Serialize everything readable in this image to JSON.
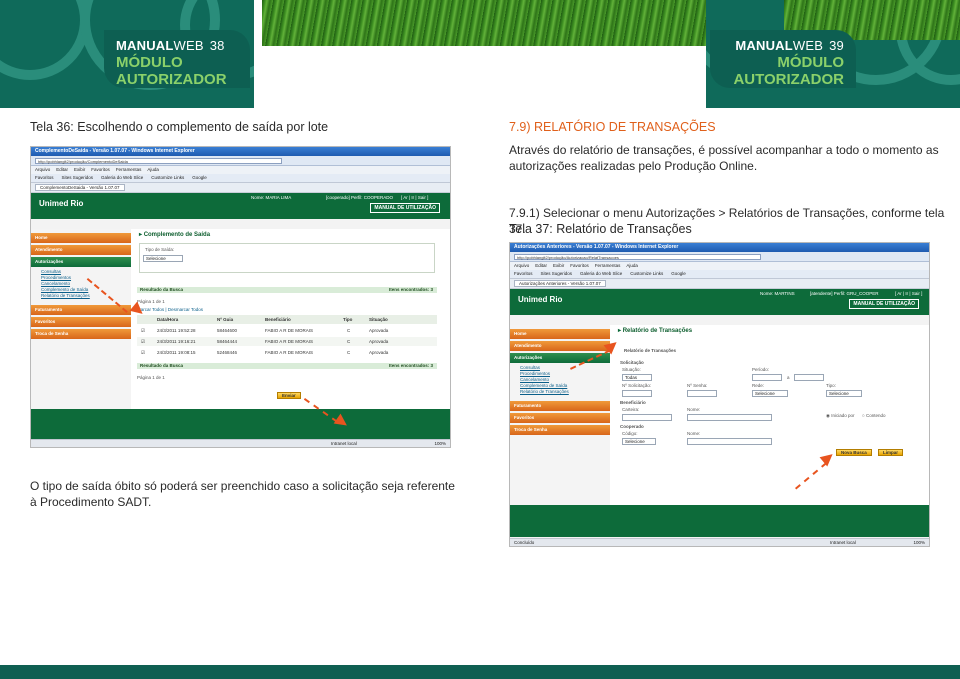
{
  "header": {
    "left": {
      "brand_bold": "MANUAL",
      "brand_light": "WEB",
      "page_number": "38",
      "module_line1": "MÓDULO",
      "module_line2": "AUTORIZADOR"
    },
    "right": {
      "brand_bold": "MANUAL",
      "brand_light": "WEB",
      "page_number": "39",
      "module_line1": "MÓDULO",
      "module_line2": "AUTORIZADOR"
    }
  },
  "left_page": {
    "caption": "Tela 36: Escolhendo o complemento de saída por lote",
    "note": "O tipo de saída óbito só poderá ser preenchido caso a solicitação seja referente à Procedimento SADT."
  },
  "right_page": {
    "heading": "7.9) RELATÓRIO DE TRANSAÇÕES",
    "intro": "Através do relatório de transações, é possível acompanhar a todo o momento as autorizações realizadas pelo Produção Online.",
    "step": "7.9.1) Selecionar o menu Autorizações > Relatórios de Transações, conforme tela 37.",
    "caption": "Tela 37: Relatório de Transações"
  },
  "screenshot1": {
    "window_title": "ComplementoDeSaida - Versão 1.07.07 - Windows Internet Explorer",
    "address": "http://pobhlanglt2/produção/ComplementoDeSaida",
    "menu": [
      "Arquivo",
      "Editar",
      "Exibir",
      "Favoritos",
      "Ferramentas",
      "Ajuda"
    ],
    "favorites": [
      "Favoritos",
      "Sites Sugeridos",
      "Galeria do Web Slice",
      "Customize Links",
      "Google"
    ],
    "tab": "ComplementoDeSaida - Versão 1.07.07",
    "logo": "Unimed Rio",
    "user": "Nome: MARIA LIMA",
    "profile": "[cooperado] Perfil: COOPERADO",
    "links": "[ Ar | Ir | Sair ]",
    "manual_btn": "MANUAL DE UTILIZAÇÃO",
    "sidebar": [
      "Home",
      "Atendimento",
      "Autorizações"
    ],
    "submenu": [
      "Consultas",
      "Procedimentos",
      "Cancelamento",
      "Complemento de Saída",
      "Relatório de Transações"
    ],
    "sidebar_bottom": [
      "Faturamento",
      "Favoritos",
      "Troca de Senha"
    ],
    "page_title": "Complemento de Saída",
    "tipo_label": "Tipo de Saída:",
    "tipo_value": "Selecione",
    "result_label": "Resultado da Busca",
    "items_found": "Itens encontrados: 3",
    "pagination": "Página 1 de 1",
    "select_all": "Marcar Todos | Desmarcar Todos",
    "columns": [
      "Data/Hora",
      "Nº Guia",
      "Beneficiário",
      "Tipo",
      "Situação"
    ],
    "rows": [
      {
        "date": "24/3/2011 19:52:28",
        "guia": "58464600",
        "ben": "FABIO A R DE MORAIS",
        "tipo": "C",
        "sit": "Aprovada"
      },
      {
        "date": "24/3/2011 19:16:21",
        "guia": "58464444",
        "ben": "FABIO A R DE MORAIS",
        "tipo": "C",
        "sit": "Aprovada"
      },
      {
        "date": "24/3/2011 19:08:15",
        "guia": "52468446",
        "ben": "FABIO A R DE MORAIS",
        "tipo": "C",
        "sit": "Aprovada"
      }
    ],
    "send_btn": "Enviar",
    "status": "Intranet local",
    "zoom": "100%"
  },
  "screenshot2": {
    "window_title": "Autorizações Anteriores - Versão 1.07.07 - Windows Internet Explorer",
    "address": "http://pobhlanglt2/produção/Autorizacao/RelatTransacoes",
    "menu": [
      "Arquivo",
      "Editar",
      "Exibir",
      "Favoritos",
      "Ferramentas",
      "Ajuda"
    ],
    "favorites": [
      "Favoritos",
      "Sites Sugeridos",
      "Galeria do Web Slice",
      "Customize Links",
      "Google"
    ],
    "tab": "Autorizações Anteriores - Versão 1.07.07",
    "logo": "Unimed Rio",
    "user": "Nome: MARTINS",
    "profile": "[atendente] Perfil: GRU_COOPER",
    "links": "[ Ar | Ir | Sair ]",
    "manual_btn": "MANUAL DE UTILIZAÇÃO",
    "sidebar": [
      "Home",
      "Atendimento",
      "Autorizações"
    ],
    "submenu": [
      "Consultas",
      "Procedimentos",
      "Cancelamento",
      "Complemento de Saída",
      "Relatório de Transações"
    ],
    "sidebar_bottom": [
      "Faturamento",
      "Favoritos",
      "Troca de Senha"
    ],
    "page_title": "Relatório de Transações",
    "filter_title": "Relatório de Transações",
    "solicitacao": "Solicitação",
    "situacao_label": "Situação:",
    "situacao_value": "Todas",
    "periodo_label": "Período:",
    "periodo_sep": "a",
    "nsolic_label": "Nº Solicitação:",
    "nsenha_label": "Nº Senha:",
    "rede_label": "Rede:",
    "rede_value": "Selecione",
    "tipo_label": "Tipo:",
    "tipo_value": "Selecione",
    "beneficiario": "Beneficiário",
    "carteira_label": "Carteira:",
    "nome_label": "Nome:",
    "iniciado_por": "Iniciado por",
    "contendo": "Contendo",
    "cooperado": "Cooperado",
    "codigo_label": "Código:",
    "codigo_value": "Selecione",
    "new_search_btn": "Nova Busca",
    "clear_btn": "Limpar",
    "status": "Concluído",
    "status2": "Intranet local",
    "zoom": "100%"
  },
  "colors": {
    "brand_green": "#0f6a5a",
    "accent_orange": "#e0601b",
    "light_green": "#8bd16a"
  }
}
